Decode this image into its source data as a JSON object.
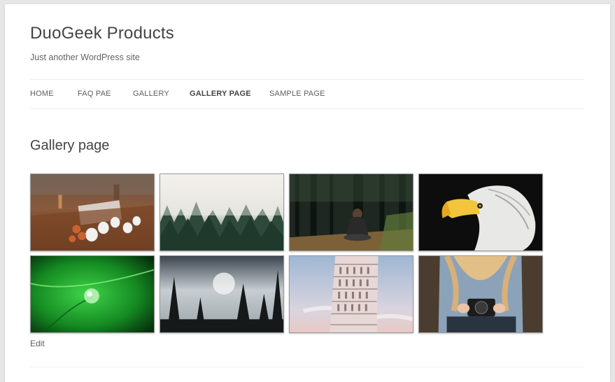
{
  "site": {
    "title": "DuoGeek Products",
    "description": "Just another WordPress site"
  },
  "nav": {
    "items": [
      {
        "label": "HOME",
        "current": false
      },
      {
        "label": "FAQ PAE",
        "current": false
      },
      {
        "label": "GALLERY",
        "current": false
      },
      {
        "label": "GALLERY PAGE",
        "current": true
      },
      {
        "label": "SAMPLE PAGE",
        "current": false
      }
    ]
  },
  "content": {
    "title": "Gallery page",
    "edit_label": "Edit"
  },
  "gallery": {
    "images": [
      {
        "subject": "coffee-cups-table"
      },
      {
        "subject": "misty-forest"
      },
      {
        "subject": "person-sitting-forest"
      },
      {
        "subject": "bald-eagle"
      },
      {
        "subject": "water-drop-leaf"
      },
      {
        "subject": "dark-trees-sky"
      },
      {
        "subject": "leaning-tower-pisa"
      },
      {
        "subject": "person-holding-camera"
      }
    ]
  }
}
